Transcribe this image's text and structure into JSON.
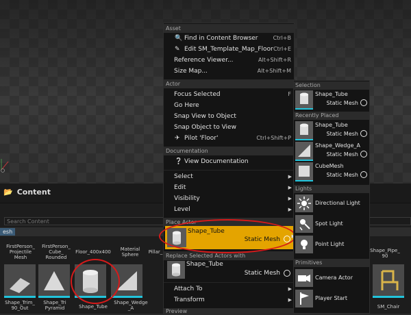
{
  "content_browser": {
    "title": "Content",
    "search_placeholder": "Search Content",
    "filter_chip": "esh",
    "column_labels": [
      "FirstPerson_\nProjectile\nMesh",
      "FirstPerson_\nCube_\nRounded",
      "Floor_400x400",
      "Material\nSphere",
      "Pillar_"
    ],
    "tiles": [
      {
        "label": "Shape_Trim_\n90_Out"
      },
      {
        "label": "Shape_Tri\nPyramid"
      },
      {
        "label": "Shape_Tube"
      },
      {
        "label": "Shape_Wedge\n_A"
      },
      {
        "label": "SM_Chair"
      }
    ],
    "right_labels": {
      "pipe": "Shape_Pipe_\n90",
      "chair": "SM_Chair"
    }
  },
  "context_menu": {
    "sections": {
      "asset": "Asset",
      "actor": "Actor",
      "documentation": "Documentation",
      "place_actor": "Place Actor",
      "replace": "Replace Selected Actors with",
      "preview": "Preview"
    },
    "asset_items": [
      {
        "label": "Find in Content Browser",
        "shortcut": "Ctrl+B",
        "icon": "magnifier-icon"
      },
      {
        "label": "Edit SM_Template_Map_Floor",
        "shortcut": "Ctrl+E",
        "icon": "edit-icon"
      },
      {
        "label": "Reference Viewer...",
        "shortcut": "Alt+Shift+R"
      },
      {
        "label": "Size Map...",
        "shortcut": "Alt+Shift+M"
      }
    ],
    "actor_items": [
      {
        "label": "Focus Selected",
        "shortcut": "F"
      },
      {
        "label": "Go Here",
        "shortcut": ""
      },
      {
        "label": "Snap View to Object",
        "shortcut": ""
      },
      {
        "label": "Snap Object to View",
        "shortcut": ""
      },
      {
        "label": "Pilot 'Floor'",
        "shortcut": "Ctrl+Shift+P",
        "icon": "pilot-icon"
      }
    ],
    "doc_item": {
      "label": "View Documentation",
      "icon": "help-icon"
    },
    "submenus": [
      "Select",
      "Edit",
      "Visibility",
      "Level"
    ],
    "place_actor": {
      "name": "Shape_Tube",
      "type": "Static Mesh"
    },
    "replace_with": {
      "name": "Shape_Tube",
      "type": "Static Mesh"
    },
    "bottom_items": [
      "Attach To",
      "Transform"
    ]
  },
  "place_submenu": {
    "sections": {
      "selection": "Selection",
      "recent": "Recently Placed",
      "lights": "Lights",
      "primitives": "Primitives"
    },
    "selection": [
      {
        "name": "Shape_Tube",
        "type": "Static Mesh"
      }
    ],
    "recent": [
      {
        "name": "Shape_Tube",
        "type": "Static Mesh"
      },
      {
        "name": "Shape_Wedge_A",
        "type": "Static Mesh"
      },
      {
        "name": "CubeMesh",
        "type": "Static Mesh"
      }
    ],
    "lights": [
      {
        "name": "Directional Light",
        "icon": "sun-icon"
      },
      {
        "name": "Spot Light",
        "icon": "spotlight-icon"
      },
      {
        "name": "Point Light",
        "icon": "bulb-icon"
      }
    ],
    "primitives": [
      {
        "name": "Camera Actor",
        "icon": "camera-icon"
      },
      {
        "name": "Player Start",
        "icon": "flag-icon"
      }
    ]
  },
  "colors": {
    "accent_orange": "#e4a400",
    "cyan": "#21c4dc",
    "highlight_red": "#d61a1a"
  }
}
